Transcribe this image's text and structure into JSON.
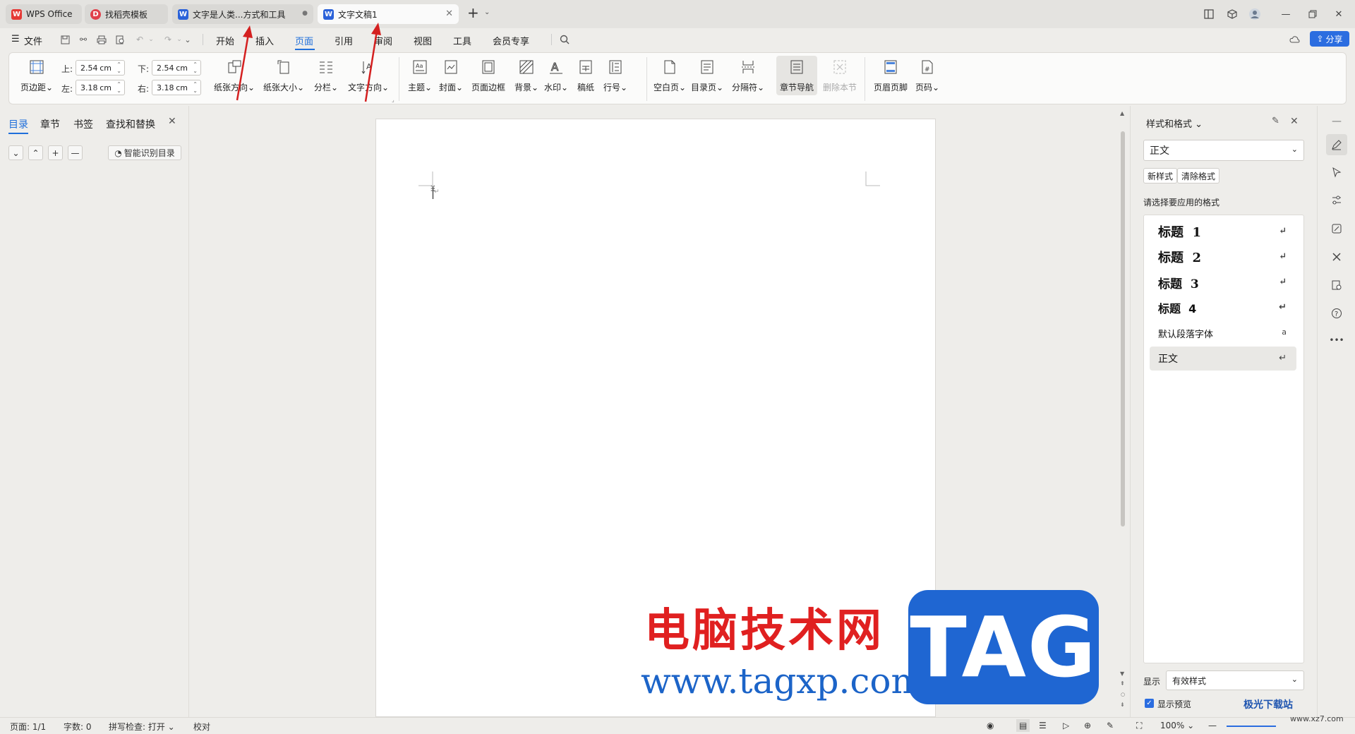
{
  "titlebar": {
    "tabs": [
      {
        "label": "WPS Office",
        "icon": "wps-logo-icon"
      },
      {
        "label": "找稻壳模板",
        "icon": "docer-icon"
      },
      {
        "label": "文字是人类...方式和工具",
        "icon": "writer-doc-icon"
      },
      {
        "label": "文字文稿1",
        "icon": "writer-doc-icon"
      }
    ],
    "new_tab": "+"
  },
  "menubar": {
    "file": "文件",
    "items": [
      "开始",
      "插入",
      "页面",
      "引用",
      "审阅",
      "视图",
      "工具",
      "会员专享"
    ],
    "active": "页面",
    "share": "分享"
  },
  "ribbon": {
    "margins_btn": "页边距",
    "top_label": "上:",
    "top_value": "2.54",
    "bottom_label": "下:",
    "bottom_value": "2.54",
    "left_label": "左:",
    "left_value": "3.18",
    "right_label": "右:",
    "right_value": "3.18",
    "unit": "cm",
    "buttons": [
      "纸张方向",
      "纸张大小",
      "分栏",
      "文字方向",
      "主题",
      "封面",
      "页面边框",
      "背景",
      "水印",
      "稿纸",
      "行号",
      "空白页",
      "目录页",
      "分隔符",
      "章节导航",
      "删除本节",
      "页眉页脚",
      "页码"
    ]
  },
  "leftnav": {
    "tabs": [
      "目录",
      "章节",
      "书签",
      "查找和替换"
    ],
    "smart_toc": "智能识别目录"
  },
  "rightpanel": {
    "title": "样式和格式",
    "current_style": "正文",
    "new_style": "新样式",
    "clear_format": "清除格式",
    "apply_label": "请选择要应用的格式",
    "styles": [
      "标题  1",
      "标题  2",
      "标题  3",
      "标题  4",
      "默认段落字体",
      "正文"
    ],
    "show_label": "显示",
    "show_value": "有效样式",
    "preview_label": "显示预览"
  },
  "status": {
    "page": "页面: 1/1",
    "words": "字数: 0",
    "spell": "拼写检查: 打开",
    "proof": "校对",
    "zoom": "100%"
  },
  "watermark": {
    "line1": "电脑技术网",
    "line2": "www.tagxp.com",
    "tag": "TAG",
    "corner1": "极光下载站",
    "corner2": "www.xz7.com"
  },
  "colors": {
    "accent": "#1f6fdb",
    "arrow": "#d42020",
    "wps_red": "#e53935",
    "writer_blue": "#2b62d9"
  }
}
